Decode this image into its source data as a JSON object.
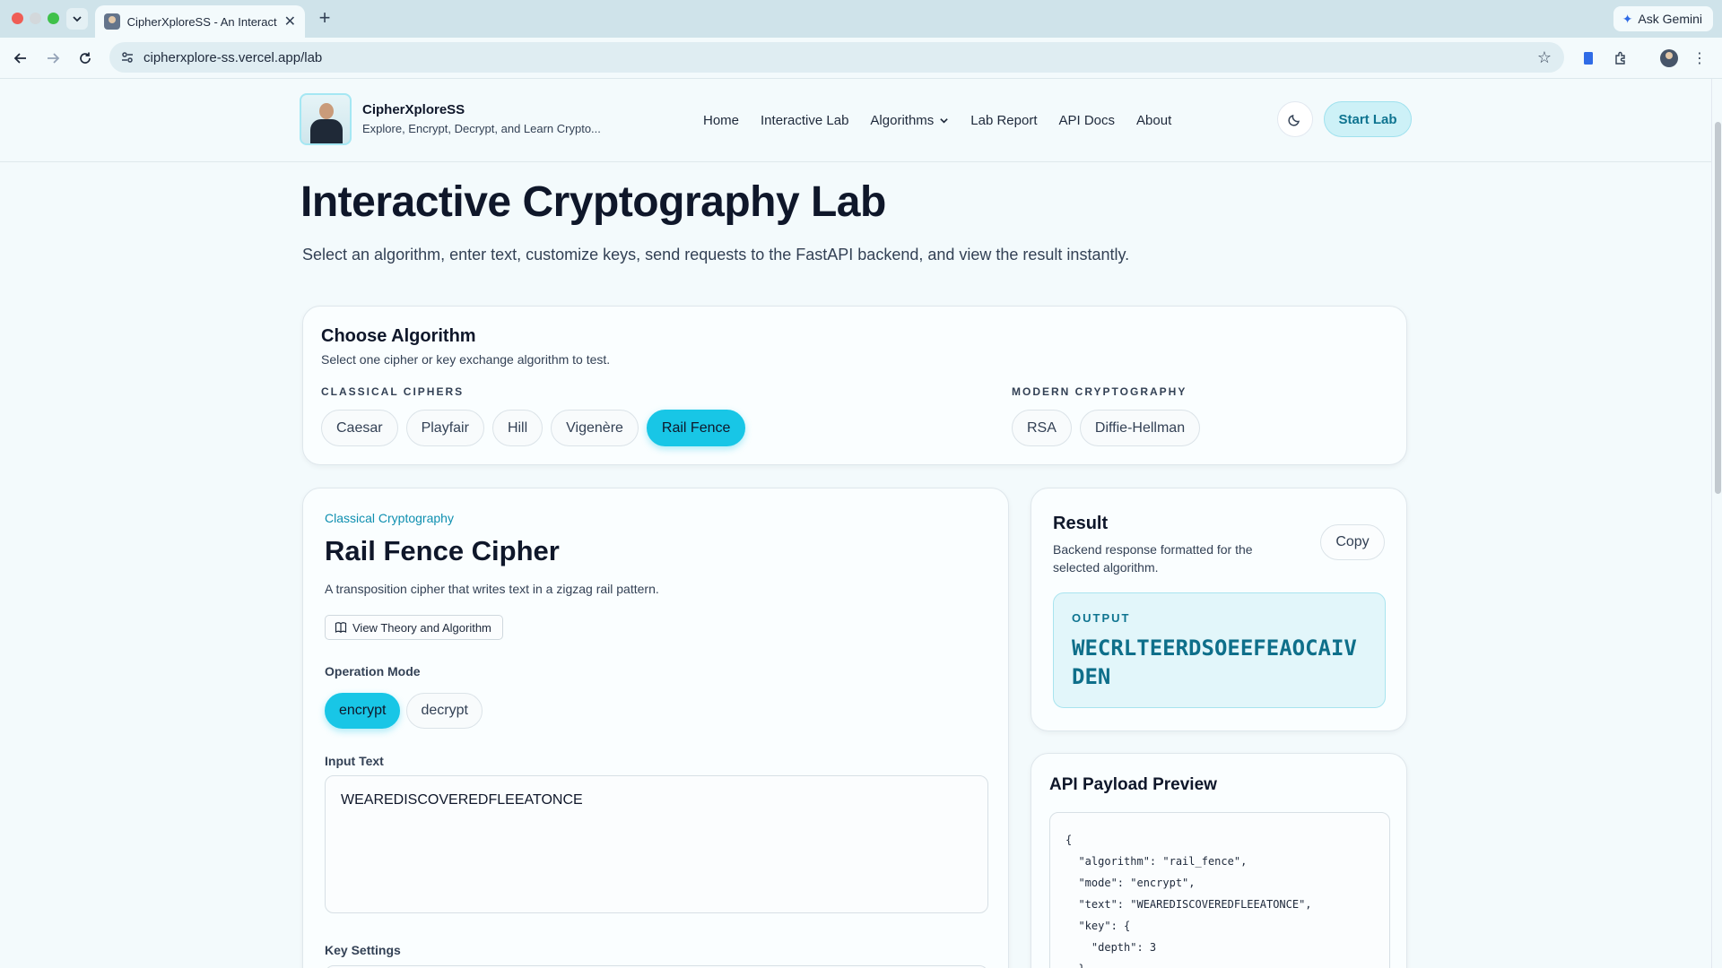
{
  "browser": {
    "tab_title": "CipherXploreSS - An Interactive Cryptography Lab",
    "url": "cipherxplore-ss.vercel.app/lab",
    "ask_gemini": "Ask Gemini"
  },
  "header": {
    "brand_name": "CipherXploreSS",
    "brand_tagline": "Explore, Encrypt, Decrypt, and Learn Crypto...",
    "nav": [
      "Home",
      "Interactive Lab",
      "Algorithms",
      "Lab Report",
      "API Docs",
      "About"
    ],
    "start_lab": "Start Lab"
  },
  "hero": {
    "title": "Interactive Cryptography Lab",
    "subtitle": "Select an algorithm, enter text, customize keys, send requests to the FastAPI backend, and view the result instantly."
  },
  "choose": {
    "title": "Choose Algorithm",
    "subtitle": "Select one cipher or key exchange algorithm to test.",
    "classical_label": "CLASSICAL CIPHERS",
    "classical": [
      "Caesar",
      "Playfair",
      "Hill",
      "Vigenère",
      "Rail Fence"
    ],
    "modern_label": "MODERN CRYPTOGRAPHY",
    "modern": [
      "RSA",
      "Diffie-Hellman"
    ],
    "selected": "Rail Fence"
  },
  "cipher": {
    "category": "Classical Cryptography",
    "title": "Rail Fence Cipher",
    "description": "A transposition cipher that writes text in a zigzag rail pattern.",
    "theory_button": "View Theory and Algorithm",
    "mode_label": "Operation Mode",
    "modes": [
      "encrypt",
      "decrypt"
    ],
    "selected_mode": "encrypt",
    "input_label": "Input Text",
    "input_value": "WEAREDISCOVEREDFLEEATONCE",
    "key_label": "Key Settings"
  },
  "result": {
    "title": "Result",
    "subtitle": "Backend response formatted for the selected algorithm.",
    "copy": "Copy",
    "output_label": "OUTPUT",
    "output_value": "WECRLTEERDSOEEFEAOCAIVDEN"
  },
  "payload": {
    "title": "API Payload Preview",
    "code": "{\n  \"algorithm\": \"rail_fence\",\n  \"mode\": \"encrypt\",\n  \"text\": \"WEAREDISCOVEREDFLEEATONCE\",\n  \"key\": {\n    \"depth\": 3\n  }"
  },
  "colors": {
    "accent": "#18c6e6",
    "accent_text": "#0e7490",
    "page_bg": "#f3fafc"
  }
}
